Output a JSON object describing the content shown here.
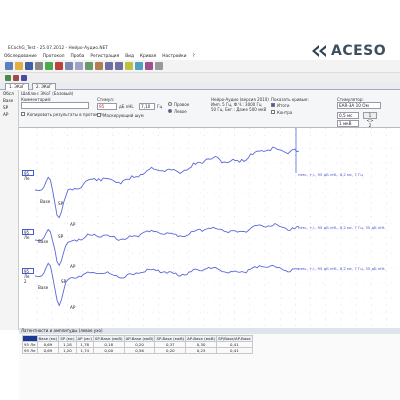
{
  "window": {
    "title": "ECochG_Test - 25.07.2012 - Нейро-Аудио.NET"
  },
  "logo": {
    "text": "ACESO"
  },
  "menu": [
    "Обследование",
    "Протокол",
    "Проба",
    "Регистрация",
    "Вид",
    "Кривая",
    "Настройки",
    "?"
  ],
  "tabs": [
    {
      "label": "1. ЭКоГ"
    },
    {
      "label": "2. ЭКоГ"
    }
  ],
  "sidebar": {
    "header": "Обсл",
    "items": [
      "Base",
      "SP",
      "AP"
    ]
  },
  "controls": {
    "template_label": "Шаблон: ЭКоГ (Базовый)",
    "comment_label": "Комментарий:",
    "copy_results_label": "Копировать результаты в протокол",
    "stimulus_label": "Стимул:",
    "level_value": "95",
    "level_unit": "дБ nHL",
    "rate_value": "7,10",
    "rate_unit": "Гц",
    "masking_label": "Маскирующий шум",
    "side_right": "Правое",
    "side_left": "Левое",
    "device_info": [
      "Нейро-Аудио (версия 2010)",
      "Имп. 5 Гц, Ф.Ч.: 3000 Гц",
      "50 Гц. Бег.: Даже 500 мкВ"
    ],
    "show_curves_label": "Показать кривые:",
    "show_curves_items": [
      "Итоги",
      "Контра"
    ],
    "stimulator_label": "Стимулятор:",
    "stimulator_value": "EAR-3A 10 Ом",
    "scale_value": "0,5 мс",
    "scale2_value": "1 мкВ",
    "button_label": "1 <> 2"
  },
  "traces": [
    {
      "label": "95 Ле",
      "annotation": "нем., +/-, 95 дБ nHL, 8,2 мс, 7 Гц",
      "peaks": [
        "Base",
        "SP",
        "AP"
      ]
    },
    {
      "label": "95 Ле",
      "annotation": "нем., +/-, 95 дБ nHL, 8,2 мс, 7 Гц, 35 дБ nHL",
      "peaks": [
        "Base",
        "SP",
        "AP"
      ]
    },
    {
      "label": "95 Ле 2",
      "annotation": "нем., +/-, 95 дБ nHL, 8,2 мс, 7 Гц, 35 дБ nHL",
      "peaks": [
        "Base",
        "SP",
        "AP"
      ]
    }
  ],
  "table": {
    "title": "Латентности и амплитуды (левое ухо)",
    "headers": [
      "",
      "Base (мс)",
      "SP (мс)",
      "AP (мс)",
      "SP-Base (мкВ)",
      "AP-Base (мкВ)",
      "SP-Base (мкВ)",
      "AP-Base (мкВ)",
      "SP/Base/AP-Base"
    ],
    "rows": [
      [
        "95 Ле",
        "0,69",
        "1,18",
        "1,78",
        "0,18",
        "0,20",
        "0,37",
        "0,30",
        "0,41"
      ],
      [
        "95 Ле",
        "0,69",
        "1,20",
        "1,74",
        "0,00",
        "0,56",
        "0,20",
        "0,25",
        "0,41"
      ]
    ]
  }
}
